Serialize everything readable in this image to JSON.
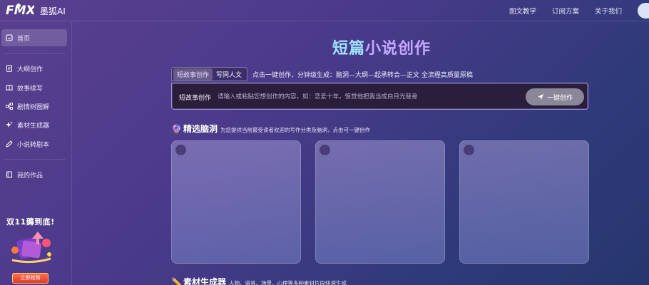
{
  "header": {
    "app_name": "墨狐AI",
    "logo_text": "FMX",
    "nav": [
      "图文教学",
      "订阅方案",
      "关于我们"
    ]
  },
  "sidebar": {
    "items": [
      {
        "label": "首页",
        "icon": "home-icon",
        "active": true
      },
      {
        "label": "大纲创作",
        "icon": "document-icon"
      },
      {
        "label": "故事续写",
        "icon": "book-icon"
      },
      {
        "label": "剧情树图解",
        "icon": "tree-icon"
      },
      {
        "label": "素材生成器",
        "icon": "sparkle-icon"
      },
      {
        "label": "小说转剧本",
        "icon": "pen-icon"
      },
      {
        "label": "我的作品",
        "icon": "folder-icon"
      }
    ],
    "promo": {
      "title": "双11薅到底!",
      "button": "立即抢购"
    }
  },
  "main": {
    "title_part1": "短篇",
    "title_part2": "小说创作",
    "tabs": [
      "短故事创作",
      "写同人文"
    ],
    "active_tab": 0,
    "tab_desc": "点击一键创作，分钟级生成：脑洞—大纲—起承转合—正文 全流程高质量原稿",
    "input": {
      "label": "短故事创作",
      "placeholder": "请输入或粘贴您想创作的内容，如：恋爱十年，惊觉他把我当成白月光替身",
      "value": ""
    },
    "create_button": "一键创作",
    "section1": {
      "emoji": "🔮",
      "title": "精选脑洞",
      "desc": "为您提供当前最受读者欢迎的写作分类及脑洞，点击可一键创作"
    },
    "section2": {
      "emoji": "✏️",
      "title": "素材生成器",
      "desc": "人物、道具、场景、心理等多种素材片段快速生成"
    }
  },
  "colors": {
    "accent_cyan": "#9fe0ff",
    "accent_purple": "#c7a8ff",
    "promo_red": "#e23a2a"
  }
}
